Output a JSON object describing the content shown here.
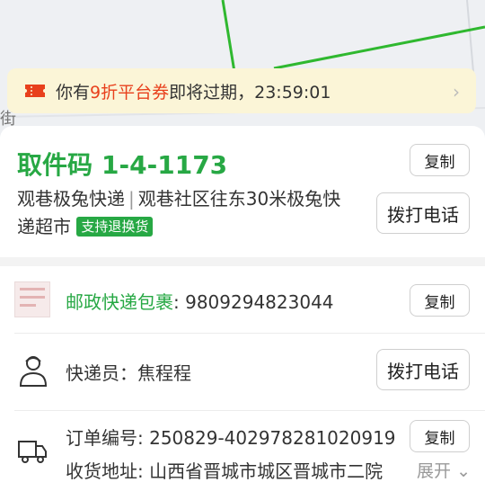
{
  "coupon": {
    "prefix": "你有",
    "highlight": "9折平台券",
    "suffix": "即将过期，23:59:01",
    "icon": "ticket-icon",
    "highlight_color": "#e8401c"
  },
  "map": {
    "street_label": "街"
  },
  "pickup": {
    "code_label": "取件码",
    "code": "1-4-1173",
    "station": "观巷极兔快递",
    "separator": "|",
    "location": "观巷社区往东30米极兔快递超市",
    "badge": "支持退换货",
    "copy_label": "复制",
    "call_label": "拨打电话",
    "accent_color": "#27a844"
  },
  "package": {
    "carrier": "邮政快递包裹",
    "tracking_number": ": 9809294823044",
    "copy_label": "复制"
  },
  "courier": {
    "label": "快递员：焦程程",
    "call_label": "拨打电话",
    "icon": "courier-icon"
  },
  "order": {
    "number_text": "订单编号: 250829-402978281020919",
    "copy_label": "复制",
    "address_text": "收货地址: 山西省晋城市城区晋城市二院",
    "expand_label": "展开",
    "icon": "truck-icon"
  }
}
